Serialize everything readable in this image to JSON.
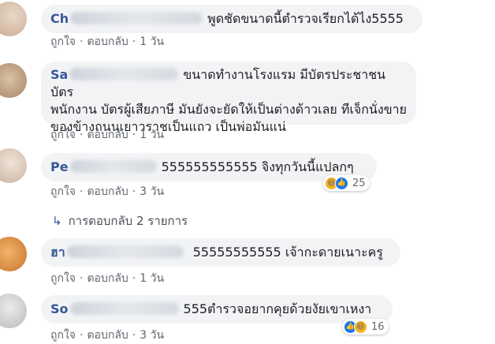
{
  "comments": [
    {
      "name": "Ch",
      "text": "พูดชัดขนาดนี้ตำรวจเรียกได้ไง5555",
      "like": "ถูกใจ",
      "reply": "ตอบกลับ",
      "time": "1 วัน"
    },
    {
      "name": "Sa",
      "text": "ขนาดทำงานโรงแรม มีบัตรประชาชน บัตรพนักงาน บัตรผู้เสียภาษี มันยังจะยัดให้เป็นต่างด้าวเลย ทีเจ็กนั่งขายของข้างถนนเยาวราชเป็นแถว เป็นพ่อมันแน่",
      "text_lines": [
        "ขนาดทำงานโรงแรม มีบัตรประชาชน บัตร",
        "พนักงาน บัตรผู้เสียภาษี มันยังจะยัดให้เป็นต่างด้าวเลย ทีเจ็กนั่งขาย",
        "ของข้างถนนเยาวราชเป็นแถว เป็นพ่อมันแน่"
      ],
      "like": "ถูกใจ",
      "reply": "ตอบกลับ",
      "time": "1 วัน"
    },
    {
      "name": "Pe",
      "text": "555555555555 จิงทุกวันนี้แปลกๆ",
      "like": "ถูกใจ",
      "reply": "ตอบกลับ",
      "time": "3 วัน",
      "reaction_count": "25",
      "reaction_icons": [
        "haha-icon",
        "like-icon"
      ]
    },
    {
      "name": "ฮา",
      "text": "55555555555 เจ้ากะดายเนาะครู",
      "like": "ถูกใจ",
      "reply": "ตอบกลับ",
      "time": "1 วัน"
    },
    {
      "name": "So",
      "text": "555ตำรวจอยากคุยด้วยงัยเขาเหงา",
      "like": "ถูกใจ",
      "reply": "ตอบกลับ",
      "time": "3 วัน",
      "reaction_count": "16",
      "reaction_icons": [
        "like-icon",
        "haha-icon"
      ]
    }
  ],
  "replies_link": "การตอบกลับ 2 รายการ",
  "separator": "·",
  "colors": {
    "bubble": "#f2f3f5",
    "name": "#385898",
    "meta": "#606770",
    "like_blue": "#1877f2",
    "haha_yellow": "#f7b125"
  }
}
